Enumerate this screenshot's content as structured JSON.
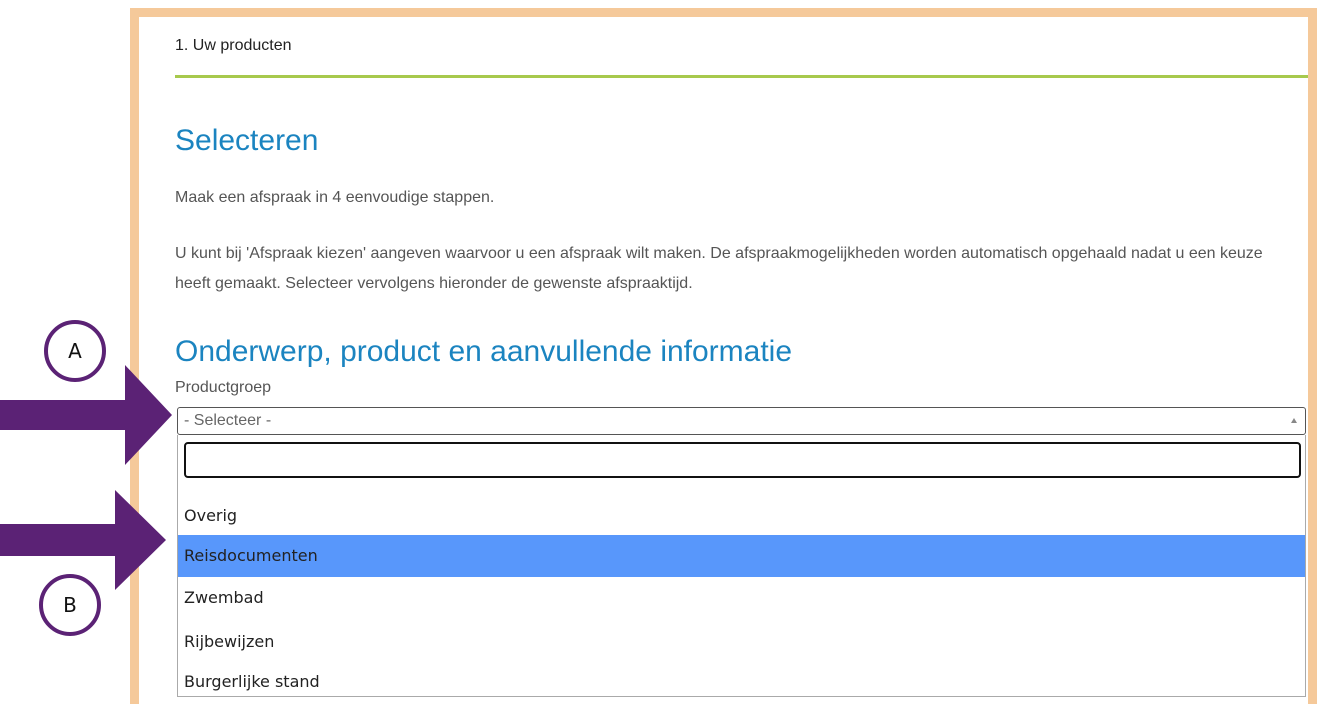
{
  "step": {
    "label": "1. Uw producten"
  },
  "content": {
    "heading_select": "Selecteren",
    "intro": "Maak een afspraak in 4 eenvoudige stappen.",
    "instruction": "U kunt bij 'Afspraak kiezen' aangeven waarvoor u een afspraak wilt maken. De afspraakmogelijkheden worden automatisch opgehaald nadat u een keuze heeft gemaakt. Selecteer vervolgens hieronder de gewenste afspraaktijd.",
    "heading_subject": "Onderwerp, product en aanvullende informatie"
  },
  "productgroep": {
    "label": "Productgroep",
    "selected": "- Selecteer -",
    "search_value": "",
    "options": [
      "Overig",
      "Reisdocumenten",
      "Zwembad",
      "Rijbewijzen",
      "Burgerlijke stand"
    ],
    "highlighted": "Reisdocumenten"
  },
  "annotations": {
    "marker_a": "A",
    "marker_b": "B",
    "color": "#5b2275"
  },
  "colors": {
    "heading": "#1b84c0",
    "step_line": "#a7c94d",
    "frame": "#f5c99a",
    "highlight": "#5897fb"
  }
}
